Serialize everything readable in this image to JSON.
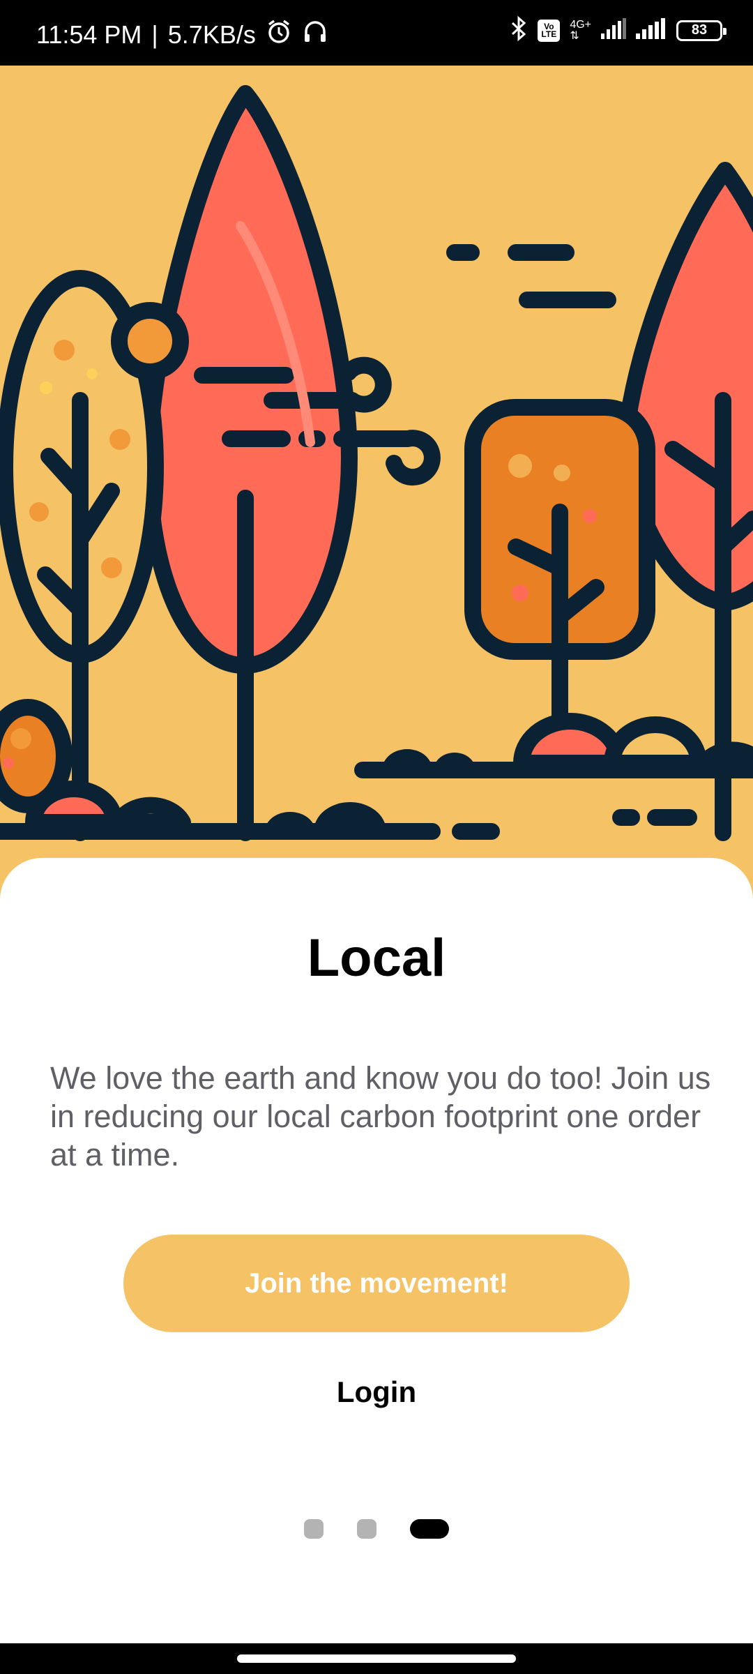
{
  "status_bar": {
    "time": "11:54 PM",
    "separator": "|",
    "network_speed": "5.7KB/s",
    "volte_label": "Vo LTE",
    "network_type": "4G+",
    "battery_level": "83",
    "icons": [
      "alarm-icon",
      "headset-icon",
      "bluetooth-icon",
      "volte-icon",
      "signal-icon",
      "signal-icon",
      "battery-icon"
    ]
  },
  "onboarding": {
    "title": "Local",
    "description": "We love the earth and know you do too! Join us in reducing our local carbon footprint one order at a time.",
    "primary_button": "Join the movement!",
    "secondary_link": "Login",
    "page_indicator": {
      "total": 3,
      "current": 3
    }
  },
  "colors": {
    "accent": "#f6c266",
    "illustration_bg": "#f6c266",
    "tree_red": "#ff6b57",
    "tree_orange": "#e98023",
    "outline": "#0b2235",
    "description_text": "#5f5f66",
    "inactive_dot": "#b3b3b3",
    "active_dot": "#000000"
  }
}
